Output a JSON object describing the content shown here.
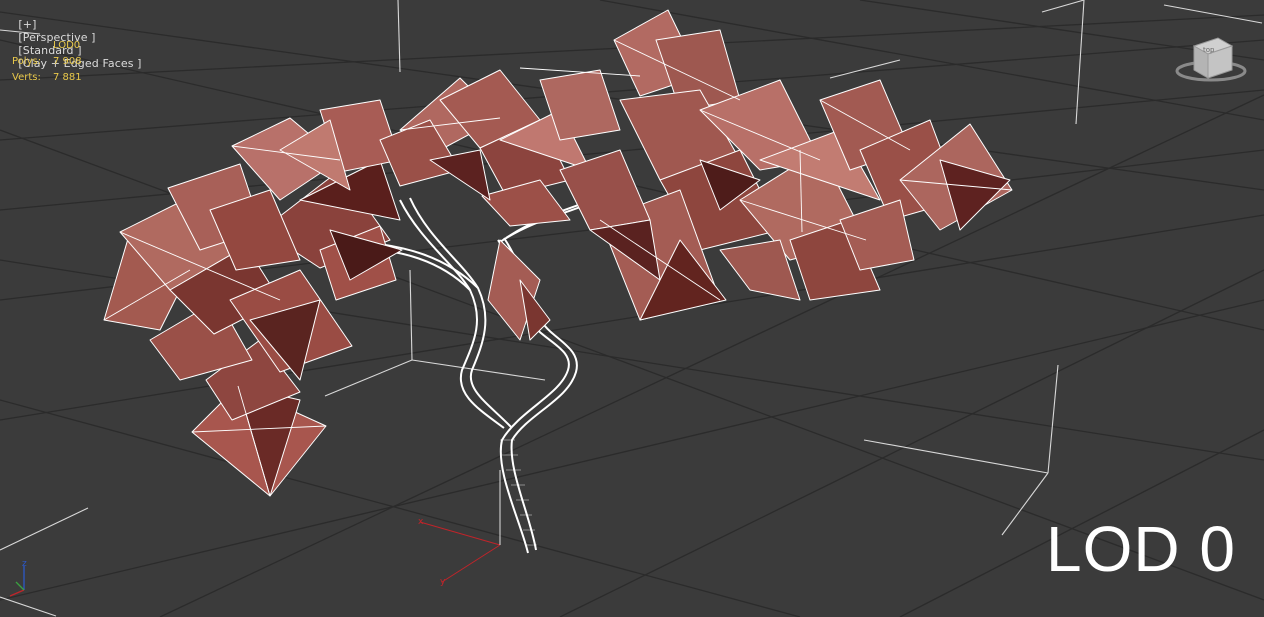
{
  "viewport": {
    "label_parts": [
      "[+]",
      "[Perspective ]",
      "[Standard ]",
      "[Clay + Edged Faces ]"
    ],
    "stats": {
      "title": "LOD0",
      "polys_label": "Polys:",
      "polys_value": "7 908",
      "verts_label": "Verts:",
      "verts_value": "7 881"
    },
    "overlay_text": "LOD 0",
    "viewcube_face": "top",
    "axis_gizmo": {
      "x": "x",
      "y": "y",
      "z": "z"
    }
  },
  "colors": {
    "background": "#3b3b3b",
    "grid": "#2b2b2b",
    "stats_text": "#e8c84a",
    "leaf_fill": "#9a5048",
    "wire": "#ffffff",
    "x_axis": "#c0242a",
    "y_axis": "#2c58c8",
    "z_axis": "#2c58c8"
  },
  "icons": [
    "viewcube-icon",
    "axis-gizmo-icon"
  ]
}
